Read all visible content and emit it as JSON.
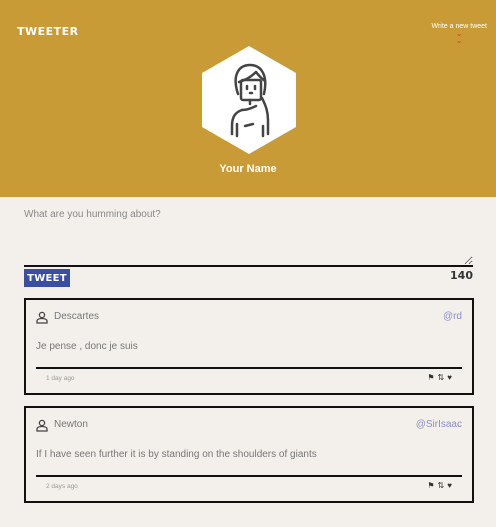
{
  "header": {
    "logo": "TWEETER",
    "compose_label": "Write a new tweet",
    "compose_icon": "double-chevron-down-icon",
    "user_name": "Your Name"
  },
  "composer": {
    "placeholder": "What are you humming about?",
    "value": "",
    "tweet_label": "TWEET",
    "counter": "140"
  },
  "tweets": [
    {
      "name": "Descartes",
      "handle": "@rd",
      "text": "Je pense , donc je suis",
      "time": "1 day ago"
    },
    {
      "name": "Newton",
      "handle": "@SirIsaac",
      "text": "If I have seen further it is by standing on the shoulders of giants",
      "time": "2 days ago"
    }
  ],
  "colors": {
    "header": "#c99b37",
    "button": "#3a4fa3",
    "handle": "#8e8cc4",
    "chevron": "#e0401a"
  }
}
